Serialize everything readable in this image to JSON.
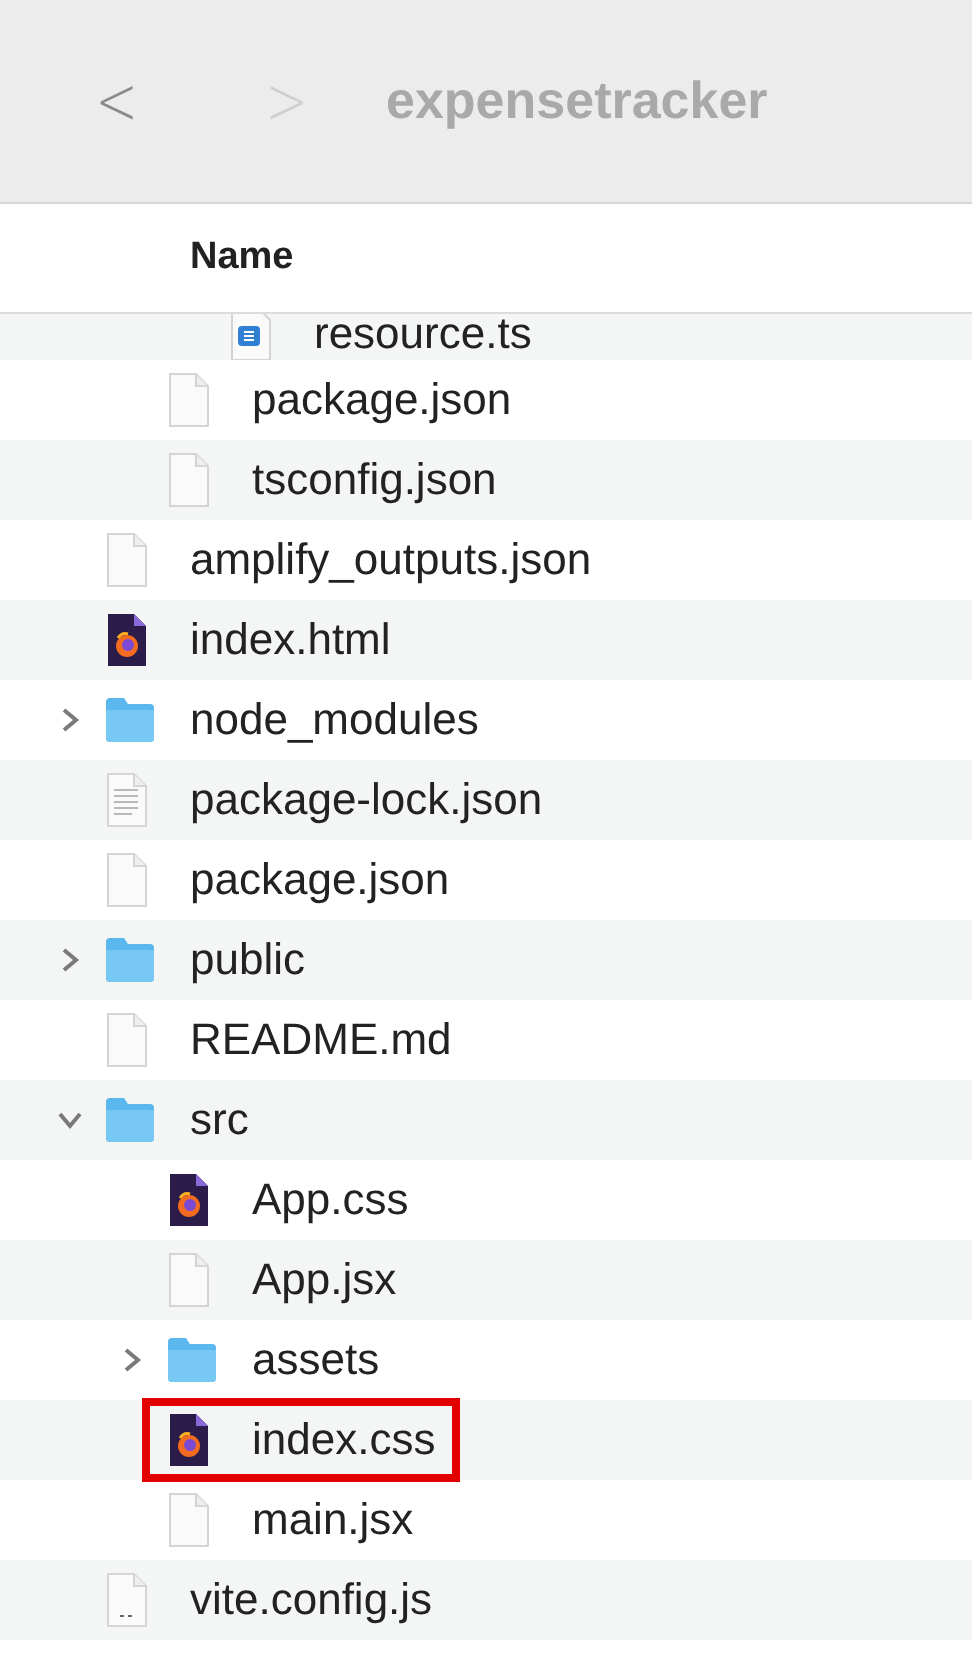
{
  "toolbar": {
    "back": {
      "label": "<",
      "disabled": false
    },
    "forward": {
      "label": ">",
      "disabled": true
    },
    "title": "expensetracker"
  },
  "columns": [
    {
      "label": "Name"
    }
  ],
  "tree": [
    {
      "children": [
        {
          "children": [
            {
              "name": "resource.ts",
              "kind": "ts"
            }
          ]
        },
        {
          "name": "package.json",
          "kind": "blank"
        },
        {
          "name": "tsconfig.json",
          "kind": "blank"
        }
      ]
    },
    {
      "name": "amplify_outputs.json",
      "kind": "blank"
    },
    {
      "name": "index.html",
      "kind": "firefox"
    },
    {
      "name": "node_modules",
      "kind": "folder",
      "expanded": false
    },
    {
      "name": "package-lock.json",
      "kind": "text"
    },
    {
      "name": "package.json",
      "kind": "blank"
    },
    {
      "name": "public",
      "kind": "folder",
      "expanded": false
    },
    {
      "name": "README.md",
      "kind": "blank"
    },
    {
      "name": "src",
      "kind": "folder",
      "expanded": true,
      "children": [
        {
          "name": "App.css",
          "kind": "firefox"
        },
        {
          "name": "App.jsx",
          "kind": "blank"
        },
        {
          "name": "assets",
          "kind": "folder",
          "expanded": false
        },
        {
          "name": "index.css",
          "kind": "firefox",
          "highlighted": true
        },
        {
          "name": "main.jsx",
          "kind": "blank"
        }
      ]
    },
    {
      "name": "vite.config.js",
      "kind": "js"
    }
  ]
}
